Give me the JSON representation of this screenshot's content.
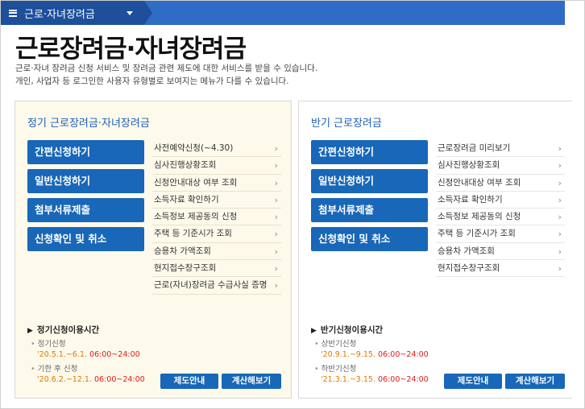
{
  "nav": {
    "breadcrumb": "근로·자녀장려금"
  },
  "page": {
    "title": "근로장려금·자녀장려금",
    "desc_line1": "근로·자녀 장려금 신청 서비스 및 장려금 관련 제도에 대한 서비스를 받을 수 있습니다.",
    "desc_line2": "개인, 사업자 등 로그인한 사용자 유형별로 보여지는 메뉴가 다를 수 있습니다."
  },
  "regular": {
    "title": "정기 근로장려금·자녀장려금",
    "buttons": [
      "간편신청하기",
      "일반신청하기",
      "첨부서류제출",
      "신청확인 및 취소"
    ],
    "links": [
      "사전예약신청(~4.30)",
      "심사진행상황조회",
      "신청안내대상 여부 조회",
      "소득자료 확인하기",
      "소득정보 제공동의 신청",
      "주택 등 기준시가 조회",
      "승용차 가액조회",
      "현지접수창구조회",
      "근로(자녀)장려금 수급사실 증명"
    ],
    "hours_title": "정기신청이용시간",
    "hours": [
      {
        "label": "정기신청",
        "date": "'20.5.1.~6.1.",
        "time": "06:00~24:00"
      },
      {
        "label": "기한 후 신청",
        "date": "'20.6.2.~12.1.",
        "time": "06:00~24:00"
      }
    ],
    "btn_guide": "제도안내",
    "btn_calc": "계산해보기"
  },
  "half": {
    "title": "반기 근로장려금",
    "buttons": [
      "간편신청하기",
      "일반신청하기",
      "첨부서류제출",
      "신청확인 및 취소"
    ],
    "links": [
      "근로장려금 미리보기",
      "심사진행상황조회",
      "신청안내대상 여부 조회",
      "소득자료 확인하기",
      "소득정보 제공동의 신청",
      "주택 등 기준시가 조회",
      "승용차 가액조회",
      "현지접수창구조회"
    ],
    "hours_title": "반기신청이용시간",
    "hours": [
      {
        "label": "상반기신청",
        "date": "'20.9.1.~9.15.",
        "time": "06:00~24:00"
      },
      {
        "label": "하반기신청",
        "date": "'21.3.1.~3.15.",
        "time": "06:00~24:00"
      }
    ],
    "btn_guide": "제도안내",
    "btn_calc": "계산해보기"
  },
  "icons": {
    "menu": "hamburger-icon",
    "dropdown": "caret-down-icon",
    "link": "chevron-right-icon",
    "section": "triangle-right-icon"
  },
  "colors": {
    "nav_bar": "#2f6cc6",
    "nav_crumb": "#1d4f9a",
    "button": "#1867b8",
    "panel_bg": "#fdfaeb",
    "time_red": "#e01b1b",
    "date_orange": "#e07a00"
  }
}
